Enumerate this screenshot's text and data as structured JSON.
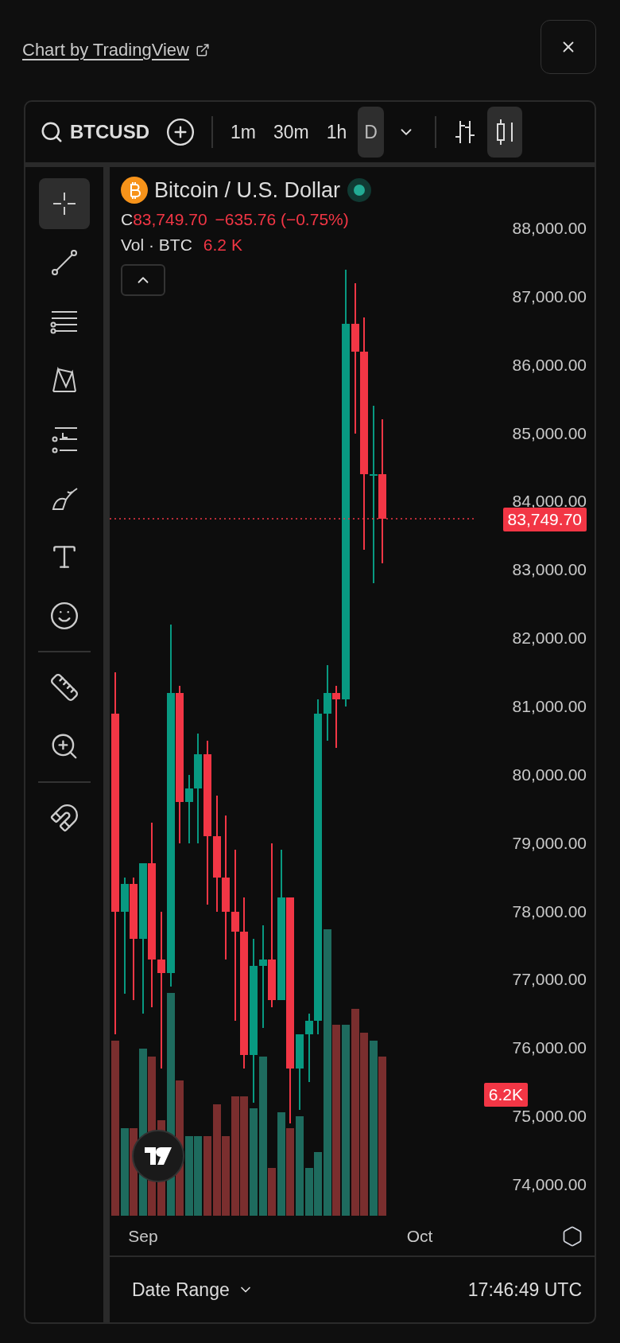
{
  "header": {
    "link": "Chart by TradingView"
  },
  "toolbar": {
    "symbol": "BTCUSD",
    "intervals": [
      {
        "label": "1m",
        "selected": false
      },
      {
        "label": "30m",
        "selected": false
      },
      {
        "label": "1h",
        "selected": false
      },
      {
        "label": "D",
        "selected": true
      }
    ],
    "chart_styles": [
      {
        "kind": "bars",
        "selected": false
      },
      {
        "kind": "candles",
        "selected": true
      }
    ]
  },
  "tools": [
    {
      "kind": "crosshair",
      "selected": true
    },
    {
      "kind": "trend-line",
      "selected": false
    },
    {
      "kind": "lines",
      "selected": false
    },
    {
      "kind": "pattern",
      "selected": false
    },
    {
      "kind": "fib",
      "selected": false
    },
    {
      "kind": "brush",
      "selected": false
    },
    {
      "kind": "text",
      "selected": false
    },
    {
      "kind": "emoji",
      "selected": false
    },
    {
      "kind": "divider"
    },
    {
      "kind": "ruler",
      "selected": false
    },
    {
      "kind": "zoom",
      "selected": false
    },
    {
      "kind": "divider"
    },
    {
      "kind": "magnet",
      "selected": false
    }
  ],
  "legend": {
    "title": "Bitcoin / U.S. Dollar",
    "close_label": "C",
    "close": "83,749.70",
    "change": "−635.76 (−0.75%)",
    "volume_label": "Vol · BTC",
    "volume": "6.2 K"
  },
  "chart": {
    "chart_data": {
      "type": "candlestick",
      "categories": [
        null,
        null,
        null,
        "Sep",
        null,
        null,
        null,
        null,
        null,
        null,
        null,
        null,
        null,
        null,
        null,
        null,
        null,
        null,
        null,
        null,
        null,
        null,
        null,
        null,
        null,
        null,
        null,
        null,
        null,
        null,
        null,
        null,
        null,
        "Oct"
      ],
      "ohlc": [
        [
          80900,
          81500,
          76200,
          78000
        ],
        [
          78000,
          78500,
          76800,
          78400
        ],
        [
          78400,
          78500,
          76700,
          77600
        ],
        [
          77600,
          78700,
          76500,
          78700
        ],
        [
          78700,
          79300,
          76600,
          77300
        ],
        [
          77300,
          78000,
          75700,
          77100
        ],
        [
          77100,
          82200,
          76900,
          81200
        ],
        [
          81200,
          81300,
          79000,
          79600
        ],
        [
          79600,
          80000,
          79000,
          79800
        ],
        [
          79800,
          80600,
          79000,
          80300
        ],
        [
          80300,
          80500,
          78100,
          79100
        ],
        [
          79100,
          79700,
          78000,
          78500
        ],
        [
          78500,
          79400,
          77300,
          78000
        ],
        [
          78000,
          78900,
          76400,
          77700
        ],
        [
          77700,
          78200,
          75700,
          75900
        ],
        [
          75900,
          77600,
          75200,
          77200
        ],
        [
          77200,
          77800,
          76300,
          77300
        ],
        [
          77300,
          79000,
          76600,
          76700
        ],
        [
          76700,
          78900,
          76700,
          78200
        ],
        [
          78200,
          78200,
          74900,
          75700
        ],
        [
          75700,
          76200,
          75100,
          76200
        ],
        [
          76200,
          76500,
          75500,
          76400
        ],
        [
          76400,
          81100,
          76200,
          80900
        ],
        [
          80900,
          81600,
          80500,
          81200
        ],
        [
          81200,
          81300,
          80400,
          81100
        ],
        [
          81100,
          87400,
          81000,
          86600
        ],
        [
          86600,
          87200,
          85000,
          86200
        ],
        [
          86200,
          86700,
          83300,
          84400
        ],
        [
          84400,
          85400,
          82800,
          84400
        ],
        [
          84400,
          85200,
          83100,
          83749.7
        ],
        null,
        null,
        null,
        null
      ],
      "ylim": [
        74000,
        88000
      ],
      "yticks": [
        {
          "value": 88000,
          "label": "88,000.00"
        },
        {
          "value": 87000,
          "label": "87,000.00"
        },
        {
          "value": 86000,
          "label": "86,000.00"
        },
        {
          "value": 85000,
          "label": "85,000.00"
        },
        {
          "value": 84000,
          "label": "84,000.00"
        },
        {
          "value": 83000,
          "label": "83,000.00"
        },
        {
          "value": 82000,
          "label": "82,000.00"
        },
        {
          "value": 81000,
          "label": "81,000.00"
        },
        {
          "value": 80000,
          "label": "80,000.00"
        },
        {
          "value": 79000,
          "label": "79,000.00"
        },
        {
          "value": 78000,
          "label": "78,000.00"
        },
        {
          "value": 77000,
          "label": "77,000.00"
        },
        {
          "value": 76000,
          "label": "76,000.00"
        },
        {
          "value": 75000,
          "label": "75,000.00"
        },
        {
          "value": 74000,
          "label": "74,000.00"
        }
      ]
    }
  },
  "price_tag": "83,749.70",
  "volume_tag": "6.2K",
  "footer": {
    "date_range": "Date Range",
    "clock": "17:46:49 UTC"
  }
}
